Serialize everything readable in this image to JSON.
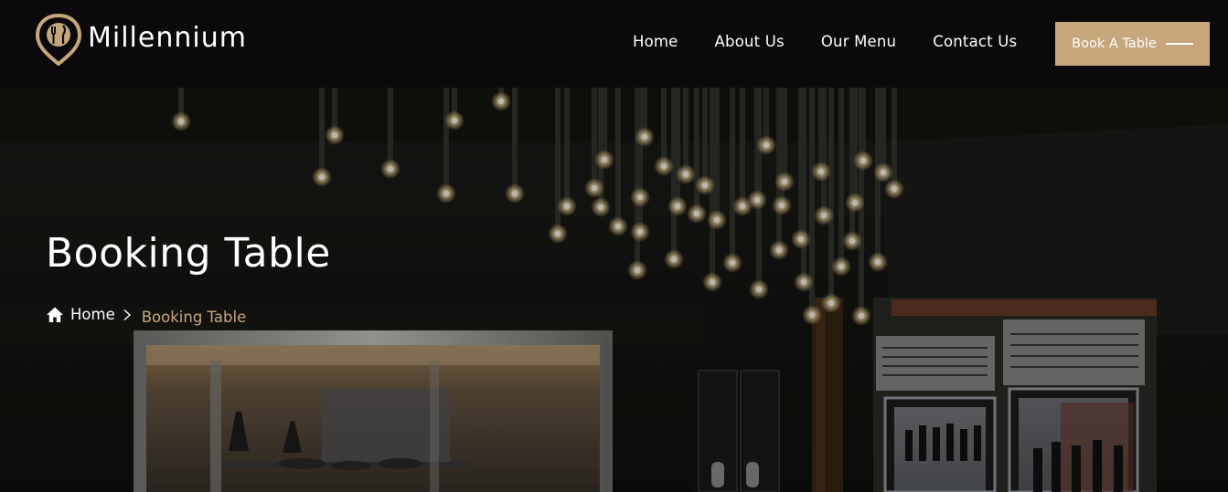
{
  "brand": {
    "name": "Millennium",
    "accent": "#c6a77b"
  },
  "nav": {
    "home": "Home",
    "about": "About Us",
    "menu": "Our Menu",
    "contact": "Contact Us"
  },
  "cta": {
    "label": "Book A Table",
    "icon": "arrow-line-icon"
  },
  "hero": {
    "title": "Booking Table",
    "background": "restaurant-interior-photo"
  },
  "breadcrumb": {
    "home_icon": "home-icon",
    "home": "Home",
    "separator_icon": "chevron-right-icon",
    "current": "Booking Table"
  }
}
